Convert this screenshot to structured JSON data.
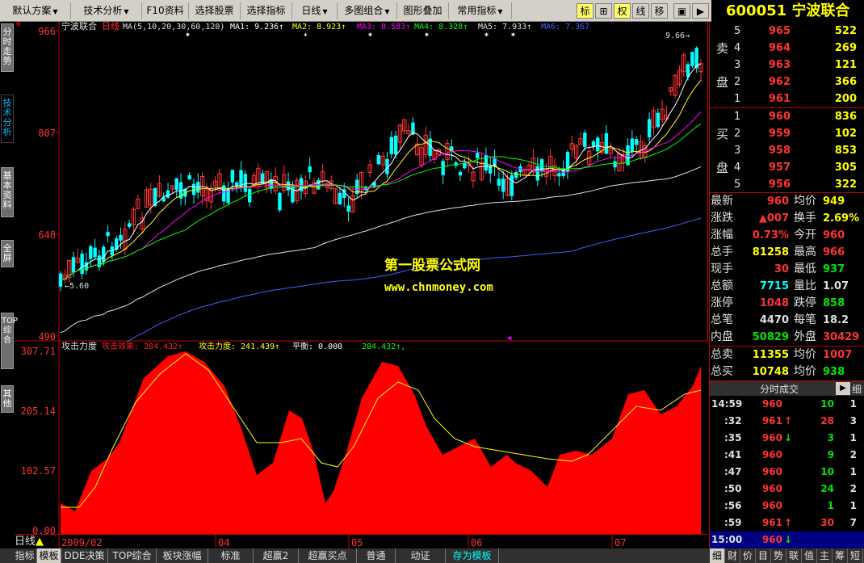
{
  "toolbar": {
    "buttons": [
      {
        "label": "默认方案",
        "arrow": true
      },
      {
        "label": "技术分析",
        "arrow": true
      },
      {
        "label": "F10资料",
        "arrow": false
      },
      {
        "label": "选择股票",
        "arrow": false
      },
      {
        "label": "选择指标",
        "arrow": false
      },
      {
        "label": "日线",
        "arrow": true
      },
      {
        "label": "多图组合",
        "arrow": true
      },
      {
        "label": "图形叠加",
        "arrow": false
      },
      {
        "label": "常用指标",
        "arrow": true
      }
    ],
    "right_tools": [
      "标",
      "⊞",
      "权",
      "线",
      "移"
    ]
  },
  "stock": {
    "code": "600051",
    "name": "宁波联合"
  },
  "sidebar": {
    "tabs": [
      "分时走势",
      "技术分析",
      "基本资料",
      "全屏",
      "TOP综合",
      "其他"
    ]
  },
  "main_chart": {
    "title": "宁波联合",
    "period": "日线",
    "ma_params": "MA(5,10,20,30,60,120)",
    "ma_labels": [
      {
        "text": "MA1: 9.236",
        "color": "#ffffff"
      },
      {
        "text": "MA2: 8.923",
        "color": "#ffff00"
      },
      {
        "text": "MA3: 8.583",
        "color": "#ff00ff"
      },
      {
        "text": "MA4: 8.328",
        "color": "#00ff00"
      },
      {
        "text": "MA5: 7.933",
        "color": "#e0e0e0"
      },
      {
        "text": "MA6: 7.367",
        "color": "#4060ff"
      }
    ],
    "y_ticks": [
      "966",
      "807",
      "648",
      "490"
    ],
    "high_label": "9.66",
    "low_label": "5.60",
    "watermark_title": "第一股票公式网",
    "watermark_url": "www.chnmoney.com"
  },
  "indicator": {
    "name": "攻击力度",
    "labels": [
      {
        "text": "攻击效果: 284.432",
        "color": "#ff2020"
      },
      {
        "text": "攻击力度: 241.439",
        "color": "#ffff00"
      },
      {
        "text": "平衡: 0.000",
        "color": "#ffffff"
      },
      {
        "text": "284.432",
        "color": "#00ff00"
      }
    ],
    "y_ticks": [
      "307.71",
      "205.14",
      "102.57",
      "0.00"
    ]
  },
  "date_axis": {
    "period": "日线",
    "labels": [
      "2009/02",
      "04",
      "05",
      "06",
      "07"
    ]
  },
  "bottombar": {
    "tabs": [
      "指标",
      "模板",
      "DDE决策",
      "TOP综合",
      "板块涨幅",
      "标准",
      "超赢2",
      "超赢买点",
      "普通",
      "动证",
      "存为模板"
    ]
  },
  "order_book": {
    "sell_label": [
      "卖",
      "盘"
    ],
    "buy_label": [
      "买",
      "盘"
    ],
    "sell": [
      {
        "level": "5",
        "price": "965",
        "vol": "522"
      },
      {
        "level": "4",
        "price": "964",
        "vol": "269"
      },
      {
        "level": "3",
        "price": "963",
        "vol": "121"
      },
      {
        "level": "2",
        "price": "962",
        "vol": "366"
      },
      {
        "level": "1",
        "price": "961",
        "vol": "200"
      }
    ],
    "buy": [
      {
        "level": "1",
        "price": "960",
        "vol": "836"
      },
      {
        "level": "2",
        "price": "959",
        "vol": "102"
      },
      {
        "level": "3",
        "price": "958",
        "vol": "853"
      },
      {
        "level": "4",
        "price": "957",
        "vol": "305"
      },
      {
        "level": "5",
        "price": "956",
        "vol": "322"
      }
    ]
  },
  "quote": [
    {
      "l1": "最新",
      "v1": "960",
      "c1": "#ff3232",
      "l2": "均价",
      "v2": "949",
      "c2": "#ffff00"
    },
    {
      "l1": "涨跌",
      "v1": "▲007",
      "c1": "#ff3232",
      "l2": "换手",
      "v2": "2.69%",
      "c2": "#ffff00"
    },
    {
      "l1": "涨幅",
      "v1": "0.73%",
      "c1": "#ff3232",
      "l2": "今开",
      "v2": "960",
      "c2": "#ff3232"
    },
    {
      "l1": "总手",
      "v1": "81258",
      "c1": "#ffff00",
      "l2": "最高",
      "v2": "966",
      "c2": "#ff3232"
    },
    {
      "l1": "现手",
      "v1": "30",
      "c1": "#ff3232",
      "l2": "最低",
      "v2": "937",
      "c2": "#00e600"
    },
    {
      "l1": "总额",
      "v1": "7715",
      "c1": "#00ffff",
      "l2": "量比",
      "v2": "1.07",
      "c2": "#e0e0e0"
    },
    {
      "l1": "涨停",
      "v1": "1048",
      "c1": "#ff3232",
      "l2": "跌停",
      "v2": "858",
      "c2": "#00e600"
    },
    {
      "l1": "总笔",
      "v1": "4470",
      "c1": "#e0e0e0",
      "l2": "每笔",
      "v2": "18.2",
      "c2": "#e0e0e0"
    },
    {
      "l1": "内盘",
      "v1": "50829",
      "c1": "#00e600",
      "l2": "外盘",
      "v2": "30429",
      "c2": "#ff3232"
    }
  ],
  "totals": [
    {
      "l1": "总卖",
      "v1": "11355",
      "c1": "#ffff00",
      "l2": "均价",
      "v2": "1007",
      "c2": "#ff3232"
    },
    {
      "l1": "总买",
      "v1": "10748",
      "c1": "#ffff00",
      "l2": "均价",
      "v2": "938",
      "c2": "#00e600"
    }
  ],
  "ticks_header": {
    "title": "分时成交",
    "detail": "细"
  },
  "ticks": [
    {
      "time": "14:59",
      "price": "960",
      "arrow": "",
      "vol": "10",
      "vcolor": "#00e600",
      "n": "1"
    },
    {
      "time": ":32",
      "price": "961",
      "arrow": "↑",
      "vol": "28",
      "vcolor": "#ff3232",
      "n": "3"
    },
    {
      "time": ":35",
      "price": "960",
      "arrow": "↓",
      "vol": "3",
      "vcolor": "#00e600",
      "n": "1"
    },
    {
      "time": ":41",
      "price": "960",
      "arrow": "",
      "vol": "9",
      "vcolor": "#00e600",
      "n": "2"
    },
    {
      "time": ":47",
      "price": "960",
      "arrow": "",
      "vol": "10",
      "vcolor": "#00e600",
      "n": "1"
    },
    {
      "time": ":50",
      "price": "960",
      "arrow": "",
      "vol": "24",
      "vcolor": "#00e600",
      "n": "2"
    },
    {
      "time": ":56",
      "price": "960",
      "arrow": "",
      "vol": "1",
      "vcolor": "#00e600",
      "n": "1"
    },
    {
      "time": ":59",
      "price": "961",
      "arrow": "↑",
      "vol": "30",
      "vcolor": "#ff3232",
      "n": "7"
    },
    {
      "time": "15:00",
      "price": "960",
      "arrow": "↓",
      "vol": "",
      "vcolor": "#00e600",
      "n": ""
    }
  ],
  "right_bottom_tabs": [
    "细",
    "财",
    "价",
    "目",
    "势",
    "联",
    "值",
    "主",
    "筹",
    "短"
  ],
  "colors": {
    "up": "#ff3232",
    "down": "#00ffff",
    "grid": "#c00000",
    "accent": "#ffff00"
  }
}
